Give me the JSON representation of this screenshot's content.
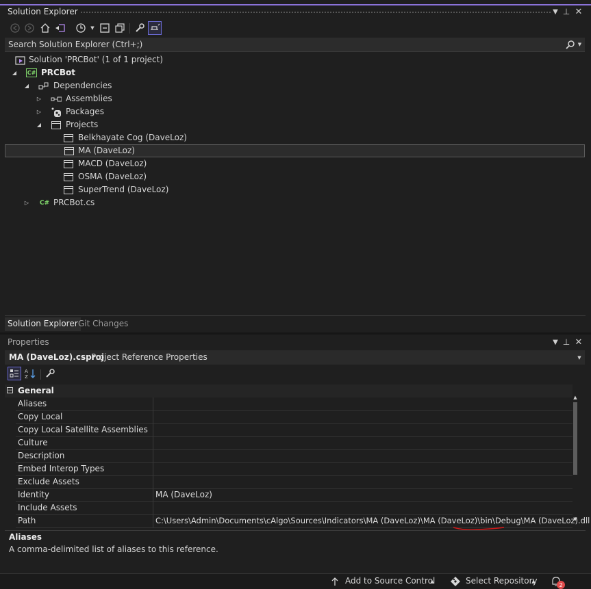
{
  "solution_explorer": {
    "title": "Solution Explorer",
    "search_placeholder": "Search Solution Explorer (Ctrl+;)",
    "tree": {
      "solution": "Solution 'PRCBot' (1 of 1 project)",
      "project": "PRCBot",
      "dependencies": "Dependencies",
      "assemblies": "Assemblies",
      "packages": "Packages",
      "projects": "Projects",
      "project_refs": [
        "Belkhayate Cog (DaveLoz)",
        "MA (DaveLoz)",
        "MACD (DaveLoz)",
        "OSMA (DaveLoz)",
        "SuperTrend (DaveLoz)"
      ],
      "file": "PRCBot.cs",
      "csharp_badge": "C#"
    },
    "tabs": [
      "Solution Explorer",
      "Git Changes"
    ]
  },
  "properties": {
    "title": "Properties",
    "object_name": "MA (DaveLoz).csproj",
    "object_type": "Project Reference Properties",
    "category": "General",
    "rows": [
      {
        "name": "Aliases",
        "value": ""
      },
      {
        "name": "Copy Local",
        "value": ""
      },
      {
        "name": "Copy Local Satellite Assemblies",
        "value": ""
      },
      {
        "name": "Culture",
        "value": ""
      },
      {
        "name": "Description",
        "value": ""
      },
      {
        "name": "Embed Interop Types",
        "value": ""
      },
      {
        "name": "Exclude Assets",
        "value": ""
      },
      {
        "name": "Identity",
        "value": "MA (DaveLoz)"
      },
      {
        "name": "Include Assets",
        "value": ""
      },
      {
        "name": "Path",
        "value": "C:\\Users\\Admin\\Documents\\cAlgo\\Sources\\Indicators\\MA (DaveLoz)\\MA (DaveLoz)\\bin\\Debug\\MA (DaveLoz).dll"
      }
    ],
    "description_title": "Aliases",
    "description_text": "A comma-delimited list of aliases to this reference."
  },
  "statusbar": {
    "add_to_source_control": "Add to Source Control",
    "select_repository": "Select Repository",
    "notification_count": "2"
  },
  "colors": {
    "accent": "#8a72d8",
    "csharp": "#7fd46a",
    "annotation": "#d11a1a",
    "badge": "#e04b4b"
  }
}
